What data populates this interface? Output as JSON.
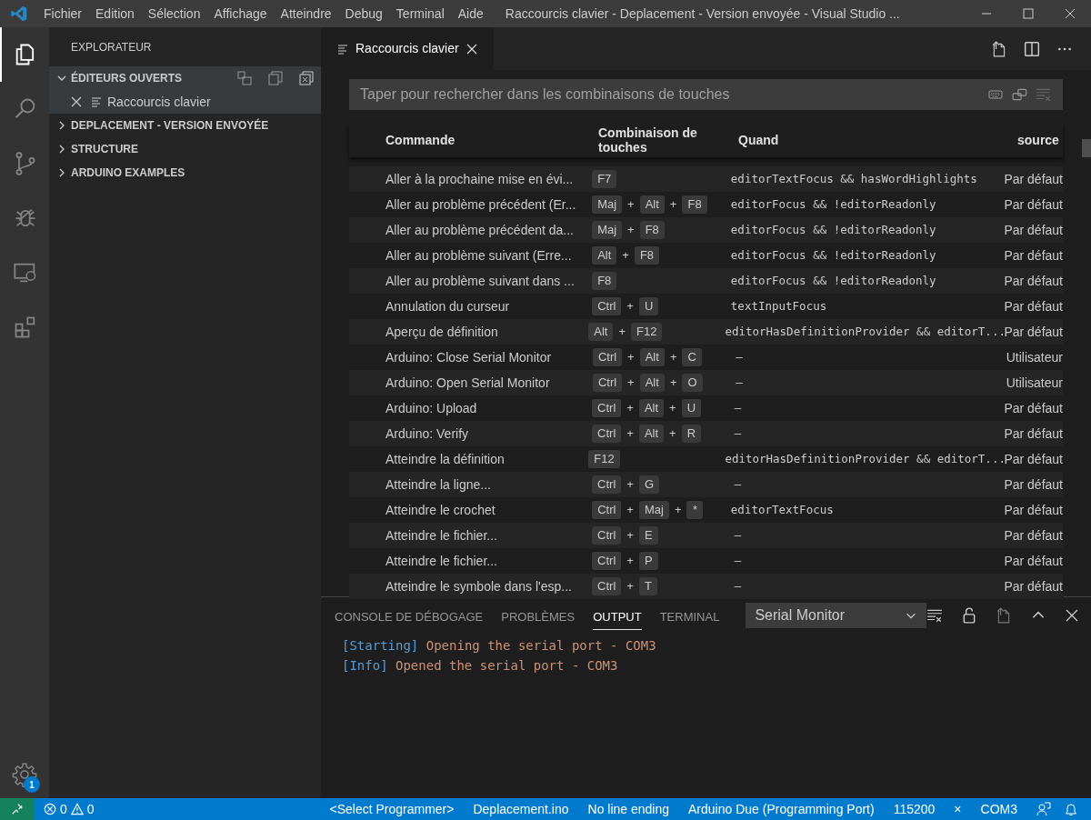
{
  "menu": [
    "Fichier",
    "Edition",
    "Sélection",
    "Affichage",
    "Atteindre",
    "Debug",
    "Terminal",
    "Aide"
  ],
  "window": {
    "title": "Raccourcis clavier - Deplacement - Version envoyée - Visual Studio ..."
  },
  "activity_bar": [
    {
      "kind": "files",
      "selected": true
    },
    {
      "kind": "search",
      "selected": false
    },
    {
      "kind": "git",
      "selected": false
    },
    {
      "kind": "debug",
      "selected": false
    },
    {
      "kind": "remote",
      "selected": false
    },
    {
      "kind": "extensions",
      "selected": false
    }
  ],
  "settings_badge": "1",
  "sidebar": {
    "title": "EXPLORATEUR",
    "sections": [
      {
        "label": "ÉDITEURS OUVERTS",
        "expanded": true,
        "children": [
          {
            "label": "Raccourcis clavier"
          }
        ]
      },
      {
        "label": "DEPLACEMENT - VERSION ENVOYÉE",
        "expanded": false
      },
      {
        "label": "STRUCTURE",
        "expanded": false
      },
      {
        "label": "ARDUINO EXAMPLES",
        "expanded": false
      }
    ]
  },
  "editor_tabs": [
    {
      "label": "Raccourcis clavier",
      "selected": true
    }
  ],
  "search": {
    "placeholder": "Taper pour rechercher dans les combinaisons de touches"
  },
  "table": {
    "columns": [
      "Commande",
      "Combinaison de touches",
      "Quand",
      "source"
    ],
    "rows": [
      {
        "command": "Aller à la prochaine mise en évi...",
        "keys": [
          "F7"
        ],
        "when": "editorTextFocus && hasWordHighlights",
        "source": "Par défaut"
      },
      {
        "command": "Aller au problème précédent (Er...",
        "keys": [
          "Maj",
          "+",
          "Alt",
          "+",
          "F8"
        ],
        "when": "editorFocus && !editorReadonly",
        "source": "Par défaut"
      },
      {
        "command": "Aller au problème précédent da...",
        "keys": [
          "Maj",
          "+",
          "F8"
        ],
        "when": "editorFocus && !editorReadonly",
        "source": "Par défaut"
      },
      {
        "command": "Aller au problème suivant (Erre...",
        "keys": [
          "Alt",
          "+",
          "F8"
        ],
        "when": "editorFocus && !editorReadonly",
        "source": "Par défaut"
      },
      {
        "command": "Aller au problème suivant dans ...",
        "keys": [
          "F8"
        ],
        "when": "editorFocus && !editorReadonly",
        "source": "Par défaut"
      },
      {
        "command": "Annulation du curseur",
        "keys": [
          "Ctrl",
          "+",
          "U"
        ],
        "when": "textInputFocus",
        "source": "Par défaut"
      },
      {
        "command": "Aperçu de définition",
        "keys": [
          "Alt",
          "+",
          "F12"
        ],
        "when": "editorHasDefinitionProvider && editorT...",
        "source": "Par défaut"
      },
      {
        "command": "Arduino: Close Serial Monitor",
        "keys": [
          "Ctrl",
          "+",
          "Alt",
          "+",
          "C"
        ],
        "when": "—",
        "source": "Utilisateur"
      },
      {
        "command": "Arduino: Open Serial Monitor",
        "keys": [
          "Ctrl",
          "+",
          "Alt",
          "+",
          "O"
        ],
        "when": "—",
        "source": "Utilisateur"
      },
      {
        "command": "Arduino: Upload",
        "keys": [
          "Ctrl",
          "+",
          "Alt",
          "+",
          "U"
        ],
        "when": "—",
        "source": "Par défaut"
      },
      {
        "command": "Arduino: Verify",
        "keys": [
          "Ctrl",
          "+",
          "Alt",
          "+",
          "R"
        ],
        "when": "—",
        "source": "Par défaut"
      },
      {
        "command": "Atteindre la définition",
        "keys": [
          "F12"
        ],
        "when": "editorHasDefinitionProvider && editorT...",
        "source": "Par défaut"
      },
      {
        "command": "Atteindre la ligne...",
        "keys": [
          "Ctrl",
          "+",
          "G"
        ],
        "when": "—",
        "source": "Par défaut"
      },
      {
        "command": "Atteindre le crochet",
        "keys": [
          "Ctrl",
          "+",
          "Maj",
          "+",
          "*"
        ],
        "when": "editorTextFocus",
        "source": "Par défaut"
      },
      {
        "command": "Atteindre le fichier...",
        "keys": [
          "Ctrl",
          "+",
          "E"
        ],
        "when": "—",
        "source": "Par défaut"
      },
      {
        "command": "Atteindre le fichier...",
        "keys": [
          "Ctrl",
          "+",
          "P"
        ],
        "when": "—",
        "source": "Par défaut"
      },
      {
        "command": "Atteindre le symbole dans l'esp...",
        "keys": [
          "Ctrl",
          "+",
          "T"
        ],
        "when": "—",
        "source": "Par défaut"
      }
    ]
  },
  "panel": {
    "tabs": [
      {
        "label": "CONSOLE DE DÉBOGAGE",
        "selected": false
      },
      {
        "label": "PROBLÈMES",
        "selected": false
      },
      {
        "label": "OUTPUT",
        "selected": true
      },
      {
        "label": "TERMINAL",
        "selected": false
      }
    ],
    "channel": "Serial Monitor",
    "output": [
      {
        "tag": "[Starting]",
        "text": "Opening the serial port - COM3"
      },
      {
        "tag": "[Info]",
        "text": "Opened the serial port - COM3"
      }
    ]
  },
  "status_bar": {
    "errors": "0",
    "warnings": "0",
    "items": [
      "<Select Programmer>",
      "Deplacement.ino",
      "No line ending",
      "Arduino Due (Programming Port)",
      "115200",
      "×",
      "COM3"
    ]
  }
}
